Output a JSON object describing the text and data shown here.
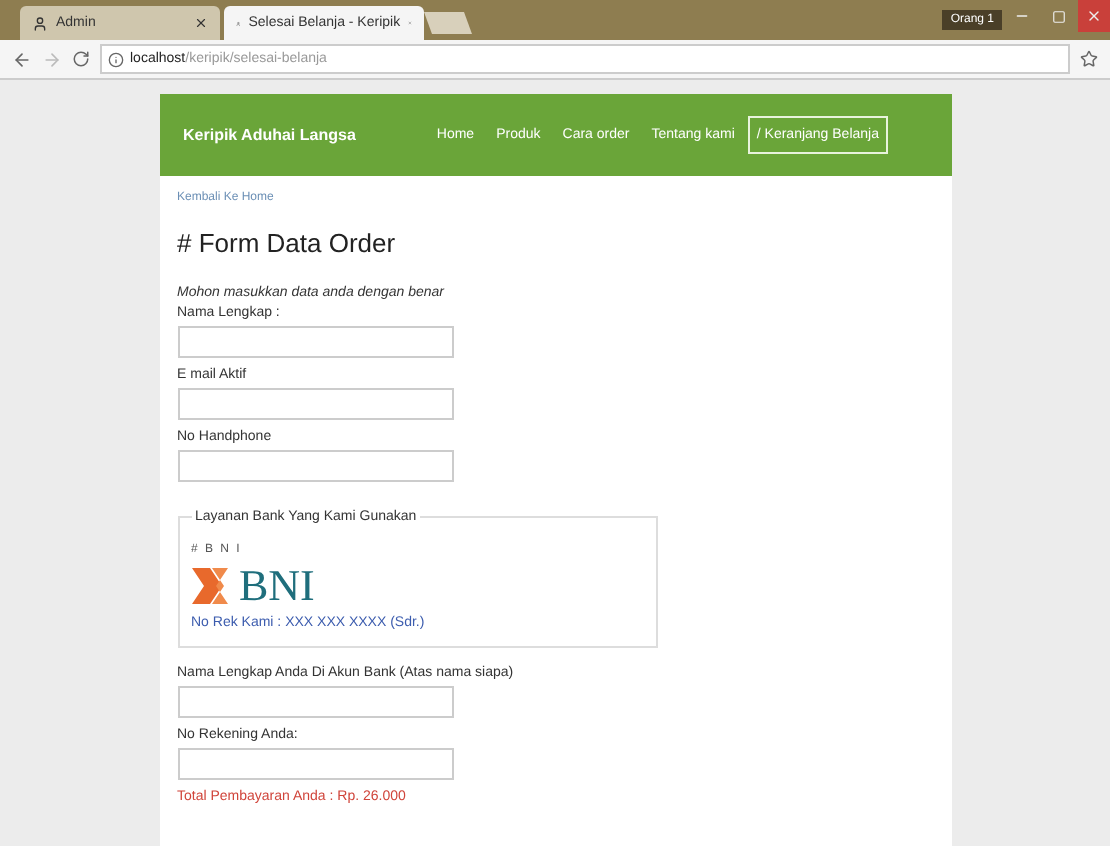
{
  "browser": {
    "tabs": [
      {
        "label": "Admin",
        "selected": false
      },
      {
        "label": "Selesai Belanja - Keripik",
        "selected": true
      }
    ],
    "profile": "Orang 1",
    "address": {
      "host": "localhost",
      "path": "/keripik/selesai-belanja"
    }
  },
  "navbar": {
    "brand": "Keripik Aduhai Langsa",
    "links": [
      {
        "label": "Home",
        "selected": false
      },
      {
        "label": "Produk",
        "selected": false
      },
      {
        "label": "Cara order",
        "selected": false
      },
      {
        "label": "Tentang kami",
        "selected": false
      },
      {
        "label": "/ Keranjang Belanja",
        "selected": true
      }
    ]
  },
  "back_link": "Kembali Ke Home",
  "heading": "# Form Data Order",
  "intro": "Mohon masukkan data anda dengan benar",
  "fields": [
    {
      "label": "Nama Lengkap :"
    },
    {
      "label": "E mail Aktif"
    },
    {
      "label": "No Handphone"
    }
  ],
  "bank": {
    "legend": "Layanan Bank Yang Kami Gunakan",
    "code": "# B N I",
    "logo": "BNI",
    "account": "No Rek Kami : XXX XXX XXXX (Sdr.)"
  },
  "bank_fields": [
    {
      "label": "Nama Lengkap Anda Di Akun Bank (Atas nama siapa)"
    },
    {
      "label": "No Rekening Anda:"
    }
  ],
  "total": "Total Pembayaran Anda : Rp. 26.000"
}
